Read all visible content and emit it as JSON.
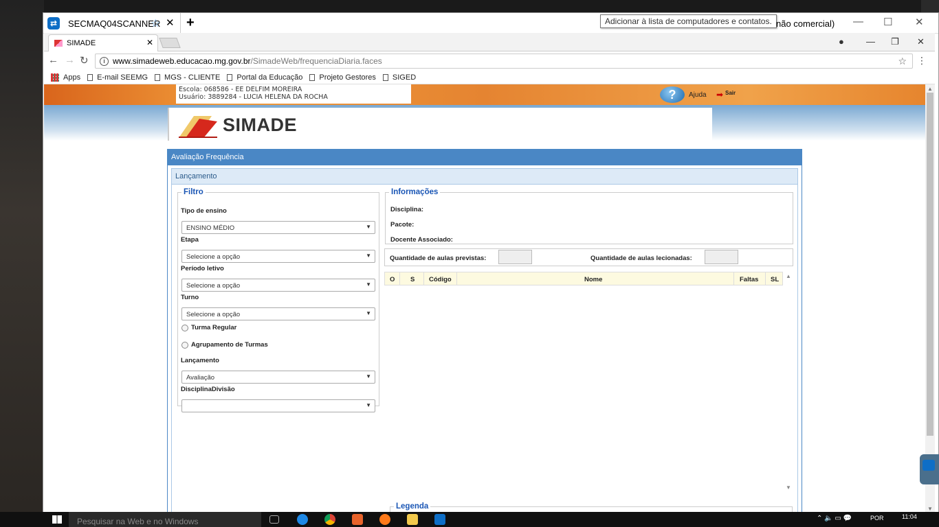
{
  "teamviewer": {
    "tab_title": "SECMAQ04SCANNER",
    "tooltip": "Adicionar à lista de computadores e contatos.",
    "right_text": "não comercial)"
  },
  "chrome": {
    "tab_title": "SIMADE",
    "url_domain": "www.simadeweb.educacao.mg.gov.br",
    "url_path": "/SimadeWeb/frequenciaDiaria.faces",
    "bookmarks": [
      "Apps",
      "E-mail SEEMG",
      "MGS - CLIENTE",
      "Portal da Educação",
      "Projeto Gestores",
      "SIGED"
    ]
  },
  "header": {
    "school": "Escola: 068586 - EE DELFIM MOREIRA",
    "user": "Usuário: 3889284 - LUCIA HELENA DA ROCHA",
    "help": "Ajuda",
    "exit": "Sair",
    "logo": "SIMADE"
  },
  "panel": {
    "title": "Avaliação Frequência",
    "subtitle": "Lançamento"
  },
  "filtro": {
    "legend": "Filtro",
    "tipo_label": "Tipo de ensino",
    "tipo_value": "ENSINO MÉDIO",
    "etapa_label": "Etapa",
    "etapa_value": "Selecione a opção",
    "periodo_label": "Período letivo",
    "periodo_value": "Selecione a opção",
    "turno_label": "Turno",
    "turno_value": "Selecione a opção",
    "radio1": "Turma Regular",
    "radio2": "Agrupamento de Turmas",
    "lancamento_label": "Lançamento",
    "lancamento_value": "Avaliação",
    "disciplina_label": "DisciplinaDivisão",
    "disciplina_value": ""
  },
  "informacoes": {
    "legend": "Informações",
    "disciplina": "Disciplina:",
    "pacote": "Pacote:",
    "docente": "Docente Associado:"
  },
  "quantidade": {
    "previstas": "Quantidade de aulas previstas:",
    "lecionadas": "Quantidade de aulas lecionadas:"
  },
  "grid": {
    "columns": [
      "O",
      "S",
      "Código",
      "Nome",
      "Faltas",
      "SL"
    ]
  },
  "legenda": "Legenda",
  "taskbar": {
    "search": "Pesquisar na Web e no Windows",
    "lang": "POR",
    "time": "11:04"
  }
}
